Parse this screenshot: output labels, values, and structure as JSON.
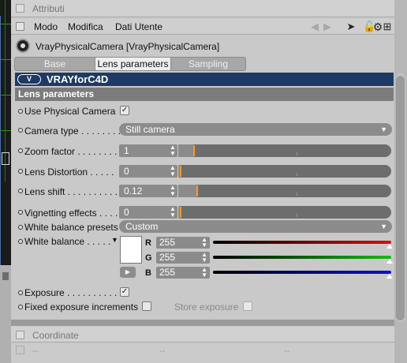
{
  "colors": {
    "banner_bg": "#1e3a64",
    "section_bg": "#7c7c7c",
    "slider_marker": "#ff9a1a",
    "red_channel": "#d21010",
    "green_channel": "#18b818",
    "blue_channel": "#1010c8"
  },
  "header": {
    "title": "Attributi"
  },
  "menu": {
    "items": [
      "Modo",
      "Modifica",
      "Dati Utente"
    ]
  },
  "toolbar_icons": [
    "arrow-left-icon",
    "arrow-right-icon",
    "cursor-icon",
    "lock-icon",
    "settings-icon",
    "add-panel-icon"
  ],
  "object": {
    "title": "VrayPhysicalCamera [VrayPhysicalCamera]",
    "icon": "camera-icon"
  },
  "tabs": [
    {
      "label": "Base",
      "active": false
    },
    {
      "label": "Lens parameters",
      "active": true
    },
    {
      "label": "Sampling",
      "active": false
    }
  ],
  "banner": {
    "logo_text": "V",
    "brand": "VRAYforC4D"
  },
  "section": {
    "title": "Lens parameters"
  },
  "params": {
    "use_physical_camera": {
      "label": "Use Physical Camera",
      "checked": true
    },
    "camera_type": {
      "label": "Camera type . . . . . . . .",
      "value": "Still camera"
    },
    "zoom_factor": {
      "label": "Zoom factor . . . . . . . . .",
      "value": "1",
      "slider_level": 0.1
    },
    "lens_distortion": {
      "label": "Lens Distortion . . . . .",
      "value": "0",
      "slider_level": 0.0
    },
    "lens_shift": {
      "label": "Lens shift . . . . . . . . . .",
      "value": "0.12",
      "slider_level": 0.12
    },
    "vignetting_effects": {
      "label": "Vignetting effects . . . .",
      "value": "0",
      "slider_level": 0.0
    },
    "white_balance_presets": {
      "label": "White balance presets",
      "value": "Custom"
    },
    "white_balance": {
      "label": "White balance . . . . .",
      "swatch_color": "#ffffff",
      "channels": [
        {
          "name": "R",
          "value": "255"
        },
        {
          "name": "G",
          "value": "255"
        },
        {
          "name": "B",
          "value": "255"
        }
      ]
    },
    "exposure": {
      "label": "Exposure . . . . . . . . . . . .",
      "checked": true
    },
    "fixed_exposure_increments": {
      "label": "Fixed exposure increments",
      "checked": false
    },
    "store_exposure": {
      "label": "Store exposure",
      "checked": false
    }
  },
  "coordinate": {
    "title": "Coordinate",
    "placeholder": "--"
  }
}
